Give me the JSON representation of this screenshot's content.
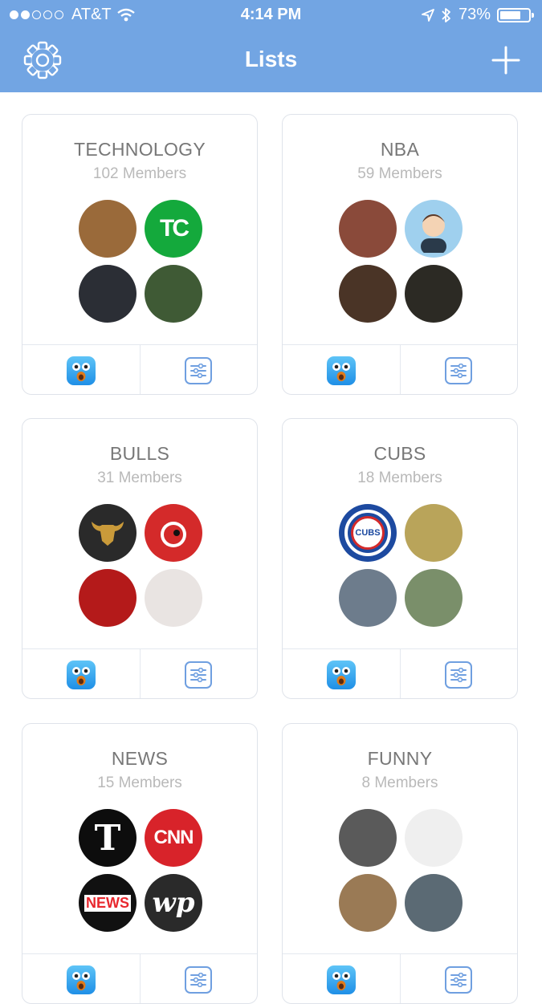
{
  "status_bar": {
    "carrier": "AT&T",
    "time": "4:14 PM",
    "battery": "73%",
    "battery_level": 0.73
  },
  "nav": {
    "title": "Lists",
    "left_icon": "gear-icon",
    "right_icon": "plus-icon"
  },
  "colors": {
    "nav_background": "#72a5e3",
    "card_border": "#dfe3ea",
    "title_text": "#777777",
    "count_text": "#b9b9b9",
    "button_accent": "#6f9fe0"
  },
  "lists": [
    {
      "title": "TECHNOLOGY",
      "members": "102 Members",
      "avatars": [
        {
          "name": "photo-avatar",
          "text": "",
          "bg": "#9a6a3a",
          "fg": "#ffffff"
        },
        {
          "name": "techcrunch-logo-avatar",
          "text": "TC",
          "bg": "#14a93c",
          "fg": "#ffffff"
        },
        {
          "name": "photo-avatar",
          "text": "",
          "bg": "#2b2e35",
          "fg": "#ffffff"
        },
        {
          "name": "photo-avatar",
          "text": "",
          "bg": "#3f5a35",
          "fg": "#ffffff"
        }
      ]
    },
    {
      "title": "NBA",
      "members": "59 Members",
      "avatars": [
        {
          "name": "photo-avatar",
          "text": "",
          "bg": "#8a4a3a",
          "fg": "#ffffff"
        },
        {
          "name": "cartoon-avatar",
          "text": "",
          "bg": "#9fd0ee",
          "fg": "#ffffff"
        },
        {
          "name": "photo-avatar",
          "text": "",
          "bg": "#4a3426",
          "fg": "#ffffff"
        },
        {
          "name": "photo-avatar",
          "text": "",
          "bg": "#2c2a24",
          "fg": "#ffffff"
        }
      ]
    },
    {
      "title": "BULLS",
      "members": "31 Members",
      "avatars": [
        {
          "name": "bulls-logo-avatar",
          "text": "",
          "bg": "#2a2a2a",
          "fg": "#c99a3a"
        },
        {
          "name": "bull-mascot-avatar",
          "text": "",
          "bg": "#d42a2a",
          "fg": "#ffffff"
        },
        {
          "name": "photo-avatar",
          "text": "",
          "bg": "#b41a1a",
          "fg": "#ffffff"
        },
        {
          "name": "photo-avatar",
          "text": "",
          "bg": "#e9e4e2",
          "fg": "#c21a1a"
        }
      ]
    },
    {
      "title": "CUBS",
      "members": "18 Members",
      "avatars": [
        {
          "name": "cubs-logo-avatar",
          "text": "CUBS",
          "bg": "#1d4aa0",
          "fg": "#ffffff"
        },
        {
          "name": "photo-avatar",
          "text": "",
          "bg": "#b9a45a",
          "fg": "#ffffff"
        },
        {
          "name": "photo-avatar",
          "text": "",
          "bg": "#6d7c8c",
          "fg": "#ffffff"
        },
        {
          "name": "photo-avatar",
          "text": "",
          "bg": "#7a8f6a",
          "fg": "#ffffff"
        }
      ]
    },
    {
      "title": "NEWS",
      "members": "15 Members",
      "avatars": [
        {
          "name": "nyt-logo-avatar",
          "text": "T",
          "bg": "#0d0d0d",
          "fg": "#ffffff"
        },
        {
          "name": "cnn-logo-avatar",
          "text": "CNN",
          "bg": "#d8232a",
          "fg": "#ffffff"
        },
        {
          "name": "buzzfeed-news-logo-avatar",
          "text": "NEWS",
          "bg": "#111111",
          "fg": "#e8282e"
        },
        {
          "name": "washington-post-logo-avatar",
          "text": "wp",
          "bg": "#2a2a2a",
          "fg": "#ffffff"
        }
      ]
    },
    {
      "title": "FUNNY",
      "members": "8 Members",
      "avatars": [
        {
          "name": "photo-avatar",
          "text": "",
          "bg": "#5a5a5a",
          "fg": "#ffffff"
        },
        {
          "name": "photo-avatar",
          "text": "",
          "bg": "#efefef",
          "fg": "#222222"
        },
        {
          "name": "photo-avatar",
          "text": "",
          "bg": "#9a7a55",
          "fg": "#ffffff"
        },
        {
          "name": "photo-avatar",
          "text": "",
          "bg": "#5b6a74",
          "fg": "#ffffff"
        }
      ]
    }
  ],
  "card_actions": {
    "left_icon": "tweetbot-icon",
    "right_icon": "list-settings-icon"
  }
}
